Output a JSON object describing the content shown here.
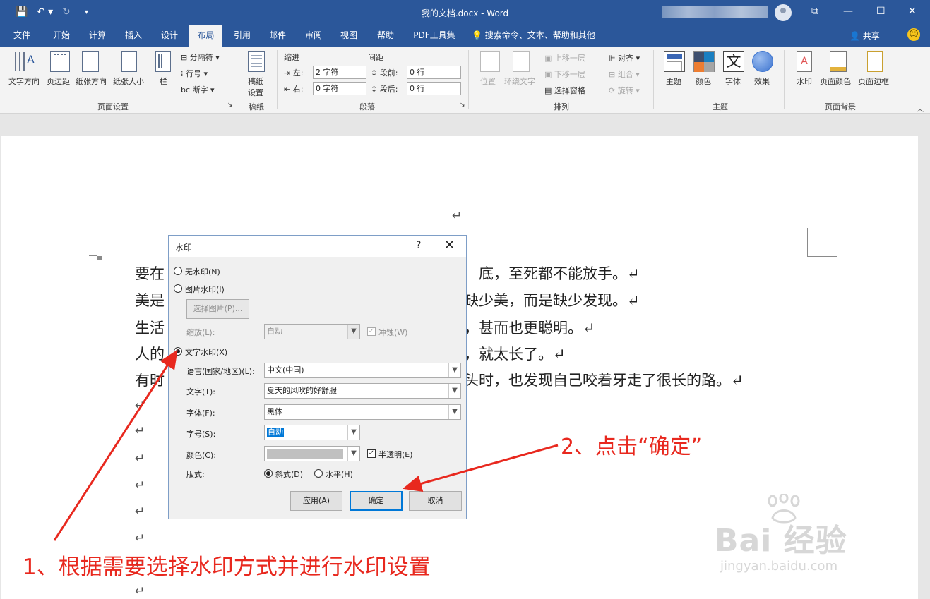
{
  "window": {
    "title": "我的文档.docx  -  Word",
    "quick_access": {
      "save": "💾",
      "undo": "↶ ▾",
      "redo": "↻",
      "customize": "▾"
    },
    "controls": {
      "restore_ribbon": "⧉",
      "minimize": "—",
      "maximize": "☐",
      "close": "✕"
    }
  },
  "tabs": [
    "文件",
    "开始",
    "计算",
    "插入",
    "设计",
    "布局",
    "引用",
    "邮件",
    "审阅",
    "视图",
    "帮助",
    "PDF工具集"
  ],
  "active_tab": "布局",
  "search": "💡  搜索命令、文本、帮助和其他",
  "share": "共享",
  "ribbon": {
    "page_setup": {
      "label": "页面设置",
      "text_direction": "文字方向",
      "margins": "页边距",
      "orientation": "纸张方向",
      "size": "纸张大小",
      "columns": "栏",
      "breaks": "分隔符 ▾",
      "line_numbers": "行号 ▾",
      "hyphenation": "断字 ▾"
    },
    "manuscript": {
      "label": "稿纸",
      "button": "稿纸",
      "button2": "设置"
    },
    "paragraph": {
      "label": "段落",
      "indent": "缩进",
      "spacing": "间距",
      "left": "左:",
      "right": "右:",
      "left_val": "2 字符",
      "right_val": "0 字符",
      "before": "段前:",
      "after": "段后:",
      "before_val": "0 行",
      "after_val": "0 行"
    },
    "arrange": {
      "label": "排列",
      "position": "位置",
      "wrap": "环绕文字",
      "forward": "上移一层",
      "backward": "下移一层",
      "pane": "选择窗格",
      "align": "对齐 ▾",
      "group": "组合 ▾",
      "rotate": "旋转 ▾"
    },
    "theme": {
      "label": "主题",
      "themes": "主题",
      "colors": "颜色",
      "fonts": "字体",
      "effects": "效果",
      "font_glyph": "文"
    },
    "background": {
      "label": "页面背景",
      "watermark": "水印",
      "page_color": "页面颜色",
      "page_border": "页面边框"
    }
  },
  "document": {
    "lines": [
      {
        "left": "要在",
        "right": "底，至死都不能放手。↵"
      },
      {
        "left": "美是",
        "right": "缺少美，而是缺少发现。↵"
      },
      {
        "left": "生活",
        "right": "，甚而也更聪明。↵"
      },
      {
        "left": "人的",
        "right": "，就太长了。↵"
      },
      {
        "left": "有时",
        "right": "头时，也发现自己咬着牙走了很长的路。↵"
      }
    ],
    "top_mark": "↵",
    "empty_marks": [
      "↵",
      "↵",
      "↵",
      "↵",
      "↵",
      "↵",
      "↵",
      "↵"
    ]
  },
  "dialog": {
    "title": "水印",
    "help": "?",
    "close": "✕",
    "no_watermark": "无水印(N)",
    "picture_watermark": "图片水印(I)",
    "select_picture": "选择图片(P)...",
    "scale_label": "缩放(L):",
    "scale_value": "自动",
    "washout": "冲蚀(W)",
    "text_watermark": "文字水印(X)",
    "language_label": "语言(国家/地区)(L):",
    "language_value": "中文(中国)",
    "text_label": "文字(T):",
    "text_value": "夏天的风吹的好舒服",
    "font_label": "字体(F):",
    "font_value": "黑体",
    "size_label": "字号(S):",
    "size_value": "自动",
    "color_label": "颜色(C):",
    "semi_transparent": "半透明(E)",
    "layout_label": "版式:",
    "diagonal": "斜式(D)",
    "horizontal": "水平(H)",
    "apply": "应用(A)",
    "ok": "确定",
    "cancel": "取消",
    "selected_option": "text_watermark",
    "selected_layout": "diagonal"
  },
  "annotations": {
    "step1": "1、根据需要选择水印方式并进行水印设置",
    "step2": "2、点击“确定”",
    "color": "#e8281e"
  },
  "site_watermark": {
    "brand": "Bai 经验",
    "url": "jingyan.baidu.com"
  }
}
